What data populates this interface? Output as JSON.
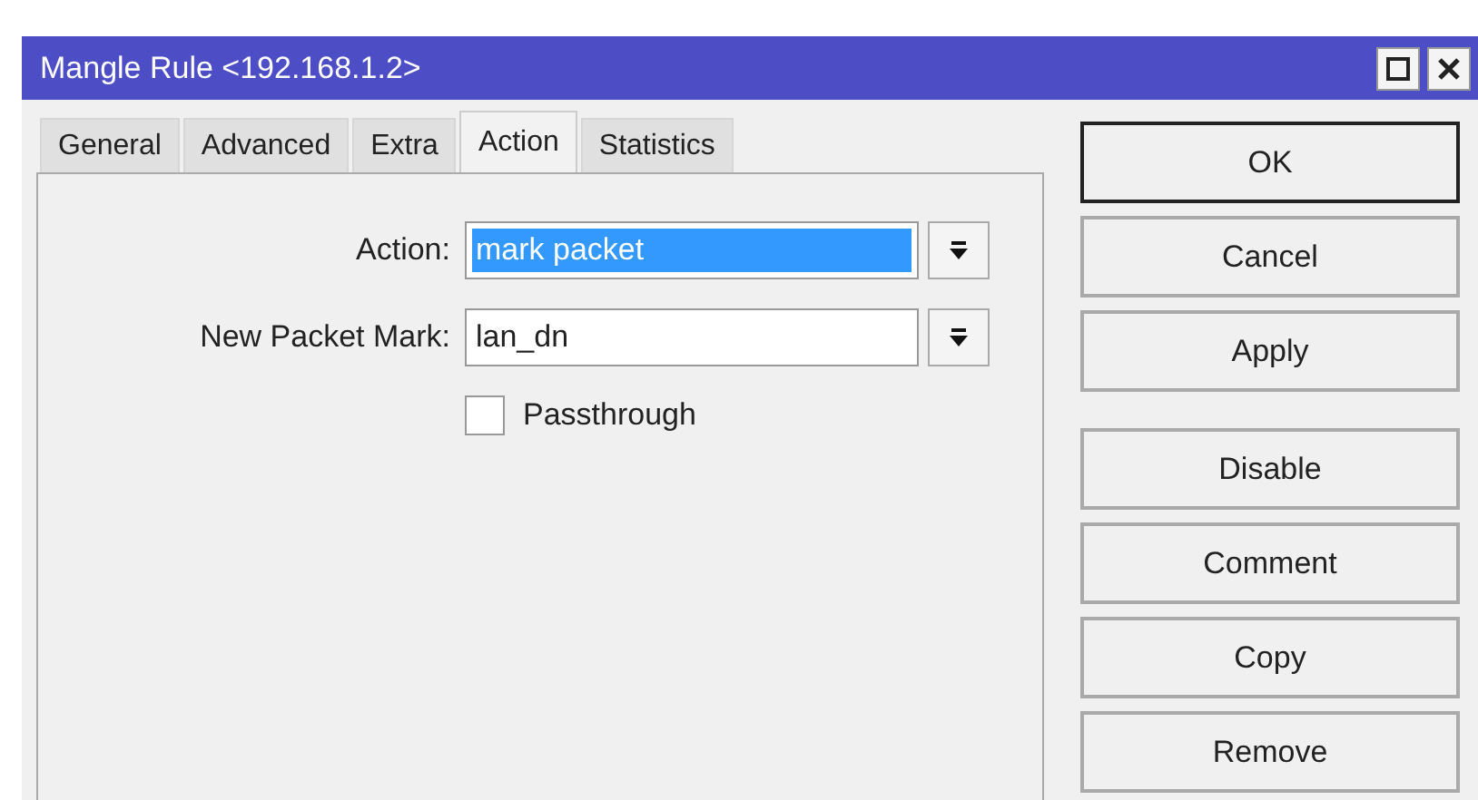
{
  "window": {
    "title": "Mangle Rule <192.168.1.2>"
  },
  "tabs": [
    {
      "label": "General",
      "selected": false
    },
    {
      "label": "Advanced",
      "selected": false
    },
    {
      "label": "Extra",
      "selected": false
    },
    {
      "label": "Action",
      "selected": true
    },
    {
      "label": "Statistics",
      "selected": false
    }
  ],
  "fields": [
    {
      "label": "Action:",
      "value": "mark packet",
      "highlighted": true
    },
    {
      "label": "New Packet Mark:",
      "value": "lan_dn",
      "highlighted": false
    }
  ],
  "passthrough": {
    "label": "Passthrough",
    "checked": false
  },
  "button_groups": [
    [
      {
        "label": "OK",
        "default": true
      },
      {
        "label": "Cancel",
        "default": false
      },
      {
        "label": "Apply",
        "default": false
      }
    ],
    [
      {
        "label": "Disable",
        "default": false
      },
      {
        "label": "Comment",
        "default": false
      },
      {
        "label": "Copy",
        "default": false
      },
      {
        "label": "Remove",
        "default": false
      }
    ]
  ]
}
